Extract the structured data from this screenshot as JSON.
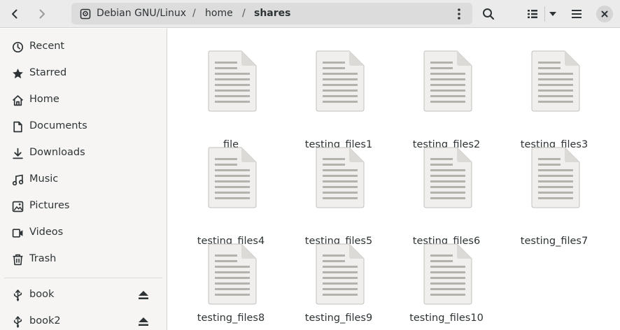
{
  "header": {
    "path": {
      "root": "Debian GNU/Linux",
      "separator": "/",
      "segments": [
        "home",
        "shares"
      ]
    },
    "icons": {
      "back": "chevron-left-icon",
      "forward": "chevron-right-icon",
      "disk": "disk-icon",
      "path_menu": "vertical-dots-icon",
      "search": "search-icon",
      "view": "list-view-icon",
      "view_dropdown": "caret-down-icon",
      "menu": "hamburger-menu-icon",
      "close": "close-icon"
    }
  },
  "sidebar": {
    "items": [
      {
        "label": "Recent",
        "icon": "clock-icon"
      },
      {
        "label": "Starred",
        "icon": "star-icon"
      },
      {
        "label": "Home",
        "icon": "home-icon"
      },
      {
        "label": "Documents",
        "icon": "document-icon"
      },
      {
        "label": "Downloads",
        "icon": "download-icon"
      },
      {
        "label": "Music",
        "icon": "music-icon"
      },
      {
        "label": "Pictures",
        "icon": "picture-icon"
      },
      {
        "label": "Videos",
        "icon": "video-icon"
      },
      {
        "label": "Trash",
        "icon": "trash-icon"
      }
    ],
    "devices": [
      {
        "label": "book",
        "icon": "usb-icon",
        "eject": "eject-icon"
      },
      {
        "label": "book2",
        "icon": "usb-icon",
        "eject": "eject-icon"
      }
    ]
  },
  "files": [
    {
      "name": "file"
    },
    {
      "name": "testing_files1"
    },
    {
      "name": "testing_files2"
    },
    {
      "name": "testing_files3"
    },
    {
      "name": "testing_files4"
    },
    {
      "name": "testing_files5"
    },
    {
      "name": "testing_files6"
    },
    {
      "name": "testing_files7"
    },
    {
      "name": "testing_files8"
    },
    {
      "name": "testing_files9"
    },
    {
      "name": "testing_files10"
    }
  ],
  "colors": {
    "headerbar": "#ebebeb",
    "pathbar": "#dcdcdc",
    "sidebar": "#f6f5f4",
    "text": "#2e3436",
    "file_icon_body": "#f0efed",
    "file_icon_lines": "#b4b2ad"
  }
}
